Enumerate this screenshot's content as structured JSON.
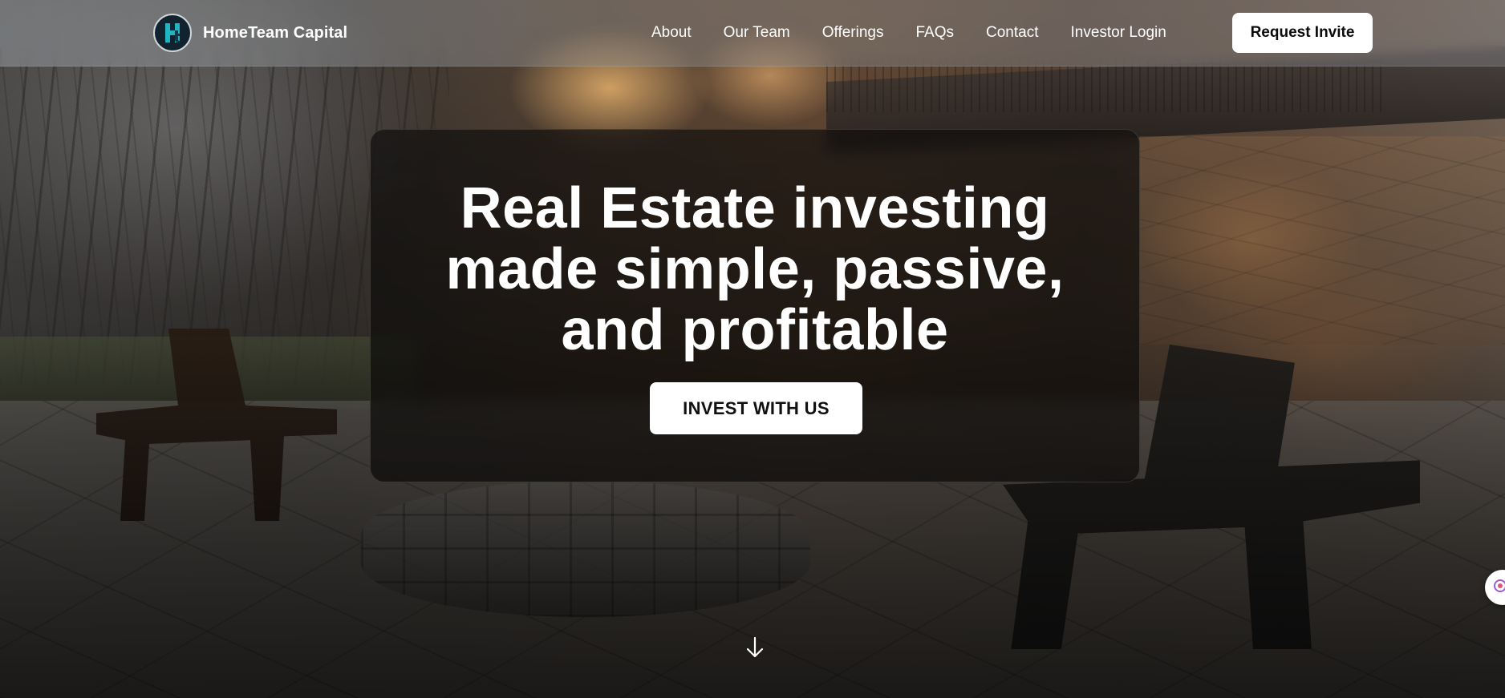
{
  "brand": {
    "name": "HomeTeam Capital",
    "logo_icon": "ht-monogram-logo-icon",
    "logo_letters": "H"
  },
  "nav": {
    "links": [
      {
        "label": "About"
      },
      {
        "label": "Our Team"
      },
      {
        "label": "Offerings"
      },
      {
        "label": "FAQs"
      },
      {
        "label": "Contact"
      },
      {
        "label": "Investor Login"
      }
    ],
    "cta_label": "Request Invite"
  },
  "hero": {
    "title_lines": [
      "Real Estate investing",
      "made simple, passive,",
      "and profitable"
    ],
    "button_label": "INVEST WITH US"
  },
  "icons": {
    "scroll": "arrow-down-icon",
    "widget": "chat-widget-icon"
  },
  "colors": {
    "logo_bg": "#10232f",
    "logo_accent": "#1fb5c4",
    "button_bg": "#ffffff",
    "button_text": "#111111",
    "text_primary": "#ffffff"
  }
}
